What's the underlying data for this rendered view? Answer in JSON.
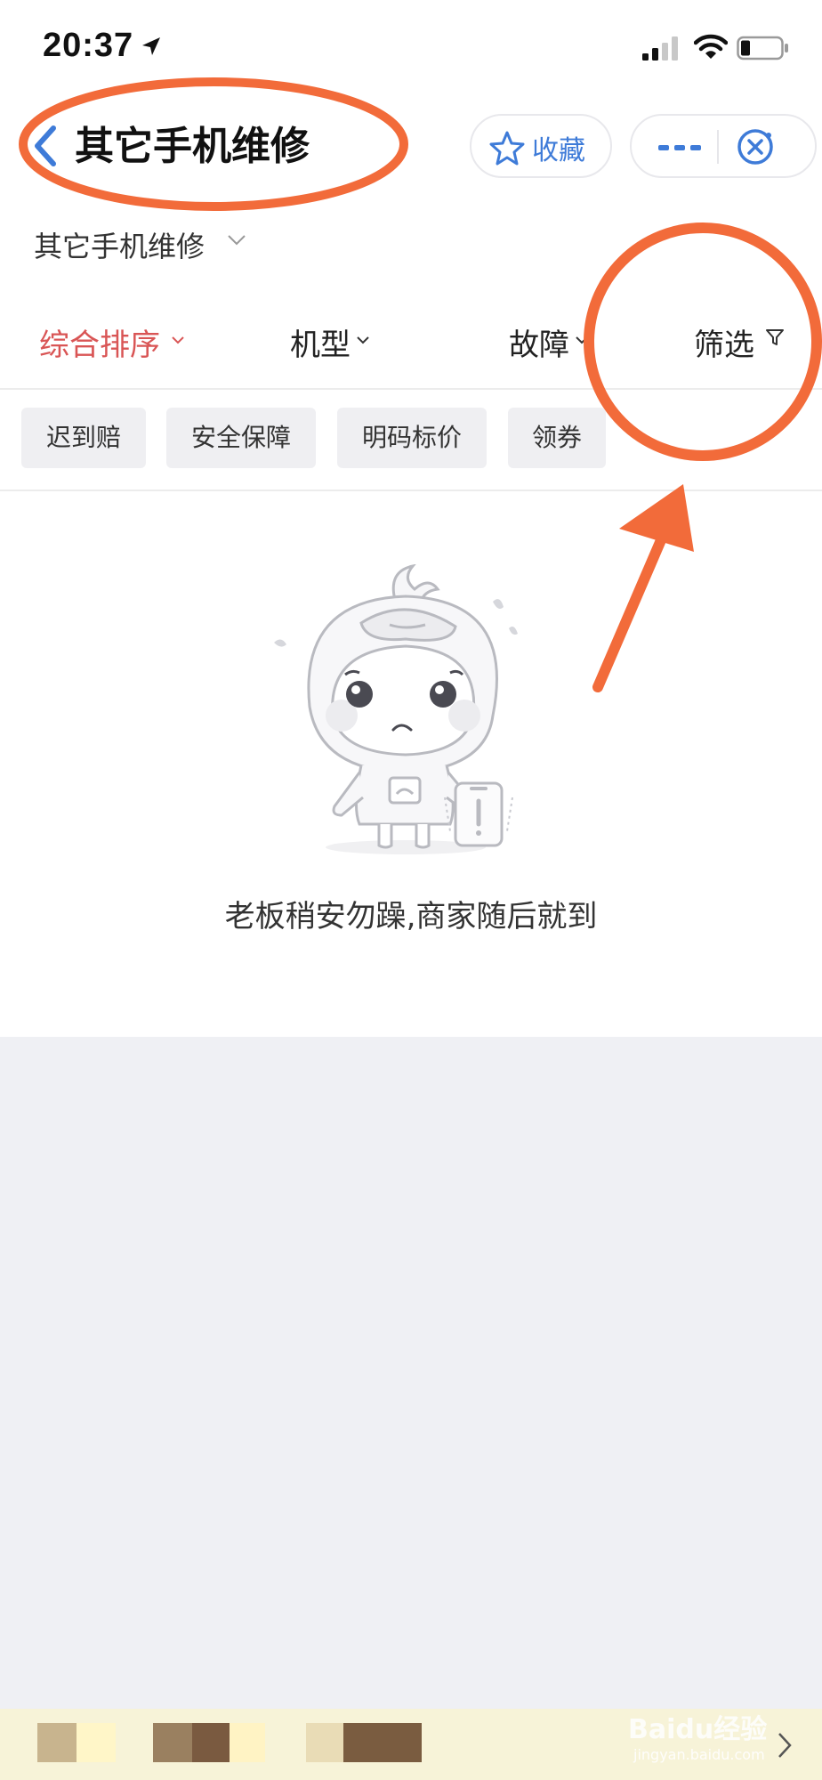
{
  "status_bar": {
    "time": "20:37",
    "icons": [
      "location-arrow-icon",
      "signal-icon",
      "wifi-icon",
      "battery-icon"
    ]
  },
  "header": {
    "title": "其它手机维修",
    "favorite_label": "收藏",
    "icons": [
      "back-icon",
      "star-icon",
      "more-icon",
      "close-icon"
    ]
  },
  "category": {
    "label": "其它手机维修"
  },
  "sort_bar": {
    "items": [
      {
        "label": "综合排序",
        "active": true
      },
      {
        "label": "机型"
      },
      {
        "label": "故障"
      },
      {
        "label": "筛选"
      }
    ],
    "active_color": "#d95555"
  },
  "tags": [
    "迟到赔",
    "安全保障",
    "明码标价",
    "领券"
  ],
  "empty_state": {
    "message": "老板稍安勿躁,商家随后就到"
  },
  "watermark": {
    "text": "Baidu经验",
    "sub": "jingyan.baidu.com"
  },
  "annotation_color": "#f26b3a",
  "accent_color": "#3e7bd8"
}
